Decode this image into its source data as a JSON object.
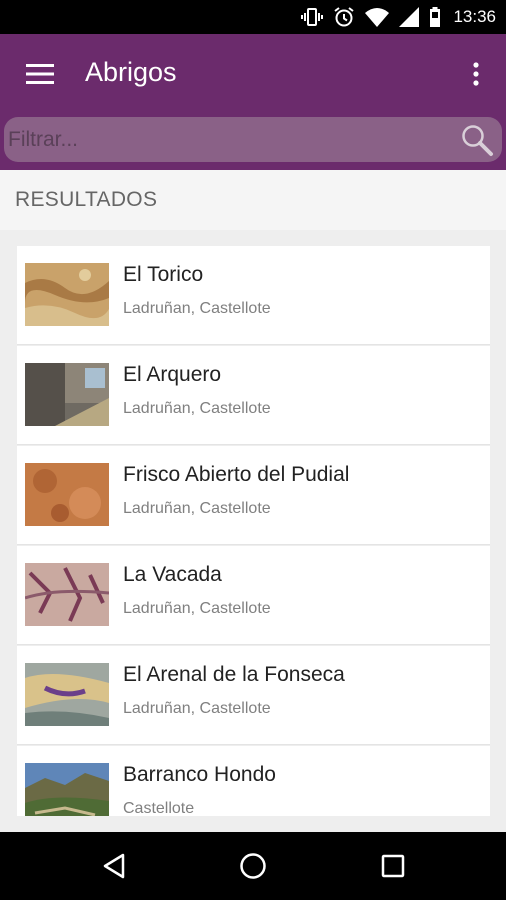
{
  "status_bar": {
    "time": "13:36"
  },
  "app_bar": {
    "title": "Abrigos"
  },
  "search": {
    "placeholder": "Filtrar...",
    "value": ""
  },
  "section": {
    "title": "RESULTADOS"
  },
  "items": [
    {
      "title": "El Torico",
      "subtitle": "Ladruñan, Castellote"
    },
    {
      "title": "El Arquero",
      "subtitle": "Ladruñan, Castellote"
    },
    {
      "title": "Frisco Abierto del Pudial",
      "subtitle": "Ladruñan, Castellote"
    },
    {
      "title": "La Vacada",
      "subtitle": "Ladruñan, Castellote"
    },
    {
      "title": "El Arenal de la Fonseca",
      "subtitle": "Ladruñan, Castellote"
    },
    {
      "title": "Barranco Hondo",
      "subtitle": "Castellote"
    }
  ],
  "colors": {
    "primary": "#6b2b6c",
    "search_field": "#8a6187"
  }
}
